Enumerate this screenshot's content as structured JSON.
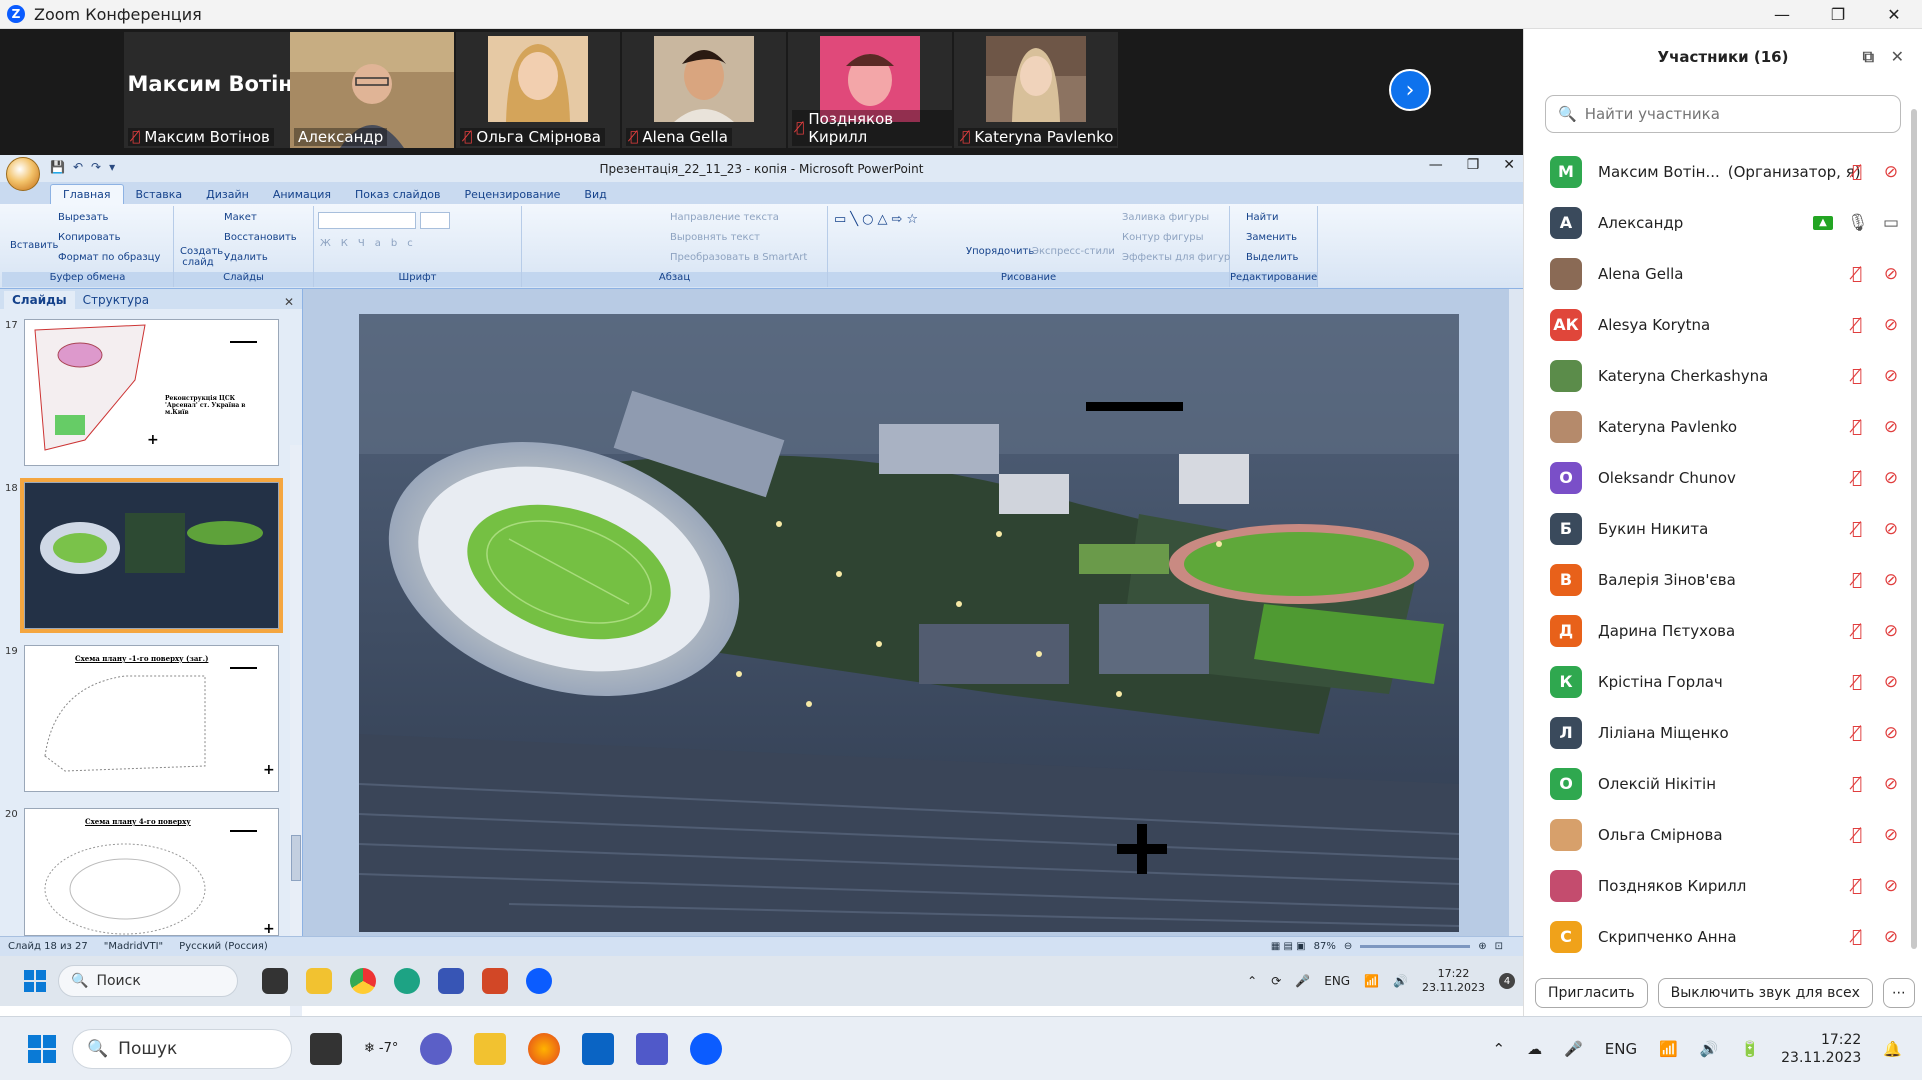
{
  "window": {
    "title": "Zoom Конференция",
    "min": "—",
    "max": "❐",
    "close": "✕"
  },
  "strip": {
    "tiles": [
      {
        "big": "Максим Вотінов",
        "name": "Максим Вотінов",
        "muted": true
      },
      {
        "name": "Александр",
        "muted": false
      },
      {
        "name": "Ольга Смірнова",
        "muted": true
      },
      {
        "name": "Alena Gella",
        "muted": true
      },
      {
        "name": "Поздняков Кирилл",
        "muted": true
      },
      {
        "name": "Kateryna Pavlenko",
        "muted": true
      }
    ],
    "next": "›"
  },
  "ppt": {
    "title": "Презентація_22_11_23 - копія - Microsoft PowerPoint",
    "tabs": [
      "Главная",
      "Вставка",
      "Дизайн",
      "Анимация",
      "Показ слайдов",
      "Рецензирование",
      "Вид"
    ],
    "groups": {
      "clipboard": {
        "label": "Буфер обмена",
        "paste": "Вставить",
        "cut": "Вырезать",
        "copy": "Копировать",
        "format": "Формат по образцу"
      },
      "slides": {
        "label": "Слайды",
        "new": "Создать слайд",
        "layout": "Макет",
        "reset": "Восстановить",
        "delete": "Удалить"
      },
      "font": {
        "label": "Шрифт"
      },
      "paragraph": {
        "label": "Абзац",
        "dir": "Направление текста",
        "align": "Выровнять текст",
        "smartart": "Преобразовать в SmartArt"
      },
      "drawing": {
        "label": "Рисование",
        "arrange": "Упорядочить",
        "styles": "Экспресс-стили",
        "fill": "Заливка фигуры",
        "outline": "Контур фигуры",
        "effects": "Эффекты для фигур"
      },
      "editing": {
        "label": "Редактирование",
        "find": "Найти",
        "replace": "Заменить",
        "select": "Выделить"
      }
    },
    "panel_tabs": [
      "Слайды",
      "Структура"
    ],
    "thumbs": [
      {
        "num": "17",
        "text": "Реконструкція ЦСК 'Арсенал' ст. Україна в м.Київ"
      },
      {
        "num": "18",
        "text": ""
      },
      {
        "num": "19",
        "text": "Схема плану -1-го поверху (заг.)"
      },
      {
        "num": "20",
        "text": "Схема плану 4-го поверху"
      }
    ],
    "status": {
      "slide": "Слайд 18 из 27",
      "theme": "\"MadridVTI\"",
      "lang": "Русский (Россия)",
      "zoom": "87%"
    }
  },
  "inner_task": {
    "search": "Поиск",
    "lang": "ENG",
    "time": "17:22",
    "date": "23.11.2023",
    "badge": "4"
  },
  "participants": {
    "title": "Участники (16)",
    "search_placeholder": "Найти участника",
    "list": [
      {
        "initial": "М",
        "color": "#2fa84f",
        "name": "Максим Вотін...",
        "role": "(Организатор, я)",
        "mic": "off",
        "video": "off"
      },
      {
        "initial": "А",
        "color": "#3a4a5c",
        "name": "Александр",
        "mic": "on",
        "video": "on",
        "share": true
      },
      {
        "initial": "",
        "color": "#8a6a55",
        "name": "Alena Gella",
        "mic": "off",
        "video": "off",
        "photo": true
      },
      {
        "initial": "АК",
        "color": "#e0463a",
        "name": "Alesya Korytna",
        "mic": "off",
        "video": "off"
      },
      {
        "initial": "",
        "color": "#5b8c4a",
        "name": "Kateryna Cherkashyna",
        "mic": "off",
        "video": "off",
        "photo": true
      },
      {
        "initial": "",
        "color": "#b58a6b",
        "name": "Kateryna Pavlenko",
        "mic": "off",
        "video": "off",
        "photo": true
      },
      {
        "initial": "O",
        "color": "#7a4fc8",
        "name": "Oleksandr Chunov",
        "mic": "off",
        "video": "off"
      },
      {
        "initial": "Б",
        "color": "#3a4a5c",
        "name": "Букин Никита",
        "mic": "off",
        "video": "off"
      },
      {
        "initial": "В",
        "color": "#e8611a",
        "name": "Валерія Зінов'єва",
        "mic": "off",
        "video": "off"
      },
      {
        "initial": "Д",
        "color": "#e8611a",
        "name": "Дарина Пєтухова",
        "mic": "off",
        "video": "off"
      },
      {
        "initial": "К",
        "color": "#2fa84f",
        "name": "Крістіна Горлач",
        "mic": "off",
        "video": "off"
      },
      {
        "initial": "Л",
        "color": "#3a4a5c",
        "name": "Ліліана Міщенко",
        "mic": "off",
        "video": "off"
      },
      {
        "initial": "О",
        "color": "#2fa84f",
        "name": "Олексій Нікітін",
        "mic": "off",
        "video": "off"
      },
      {
        "initial": "",
        "color": "#d7a06b",
        "name": "Ольга Смірнова",
        "mic": "off",
        "video": "off",
        "photo": true
      },
      {
        "initial": "",
        "color": "#c44c6e",
        "name": "Поздняков Кирилл",
        "mic": "off",
        "video": "off",
        "photo": true
      },
      {
        "initial": "С",
        "color": "#f0a21a",
        "name": "Скрипченко Анна",
        "mic": "off",
        "video": "off"
      }
    ],
    "invite": "Пригласить",
    "mute_all": "Выключить звук для всех",
    "more": "⋯"
  },
  "taskbar": {
    "search": "Пошук",
    "weather": "-7°",
    "lang": "ENG",
    "time": "17:22",
    "date": "23.11.2023"
  }
}
